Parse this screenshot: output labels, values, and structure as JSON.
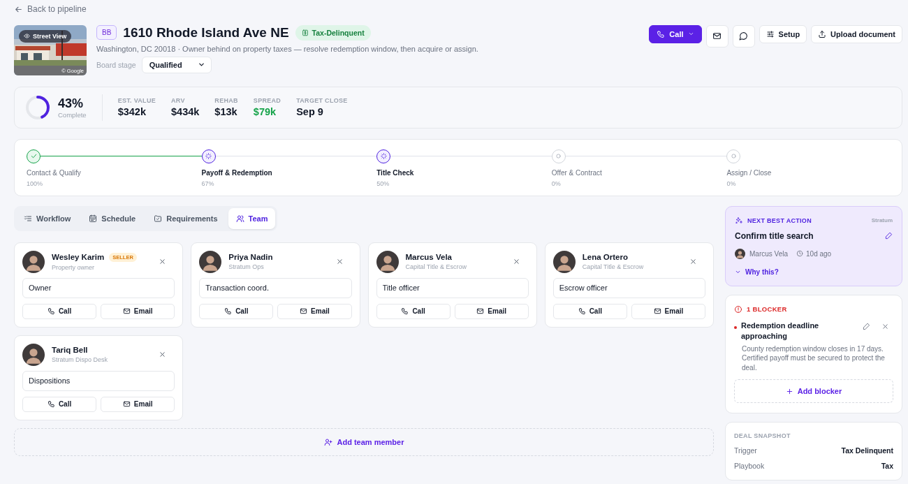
{
  "back_link": "Back to pipeline",
  "property": {
    "photo": {
      "kind": "picture",
      "badge": "Street View",
      "credit": "© Google"
    },
    "initials": "BB",
    "title": "1610 Rhode Island Ave NE",
    "tag": "Tax-Delinquent",
    "description": "Washington, DC 20018 · Owner behind on property taxes — resolve redemption window, then acquire or assign.",
    "board_stage": {
      "label": "Board stage",
      "value": "Qualified"
    }
  },
  "actions": [
    {
      "kind": "call",
      "label": "Call"
    },
    {
      "kind": "email"
    },
    {
      "kind": "message"
    },
    {
      "kind": "setup",
      "label": "Setup"
    },
    {
      "kind": "upload",
      "label": "Upload document"
    }
  ],
  "progress": {
    "level": 0.43,
    "percent": "43%",
    "caption": "Complete"
  },
  "stats": [
    {
      "label": "EST. VALUE",
      "value": "$342k",
      "color": "#111827"
    },
    {
      "label": "ARV",
      "value": "$434k",
      "color": "#111827"
    },
    {
      "label": "REHAB",
      "value": "$13k",
      "color": "#111827"
    },
    {
      "label": "SPREAD",
      "value": "$79k",
      "color": "#16a34a"
    },
    {
      "label": "TARGET CLOSE",
      "value": "Sep 9",
      "color": "#111827"
    }
  ],
  "stages": [
    {
      "name": "Contact & Qualify",
      "percent": "100%",
      "done": true,
      "active": false
    },
    {
      "name": "Payoff & Redemption",
      "percent": "67%",
      "done": false,
      "active": true
    },
    {
      "name": "Title Check",
      "percent": "50%",
      "done": false,
      "active": true
    },
    {
      "name": "Offer & Contract",
      "percent": "0%",
      "done": false,
      "active": false
    },
    {
      "name": "Assign / Close",
      "percent": "0%",
      "done": false,
      "active": false
    }
  ],
  "tabs": [
    {
      "kind": "workflow",
      "label": "Workflow",
      "selected": false
    },
    {
      "kind": "schedule",
      "label": "Schedule",
      "selected": false
    },
    {
      "kind": "requirements",
      "label": "Requirements",
      "selected": false
    },
    {
      "kind": "team",
      "label": "Team",
      "selected": true
    }
  ],
  "team": [
    {
      "name": "Wesley Karim",
      "tag": "SELLER",
      "org": "Property owner",
      "role": "Owner",
      "buttons": [
        "Call",
        "Email"
      ]
    },
    {
      "name": "Priya Nadin",
      "org": "Stratum Ops",
      "role": "Transaction coord.",
      "buttons": [
        "Call",
        "Email"
      ]
    },
    {
      "name": "Marcus Vela",
      "org": "Capital Title & Escrow",
      "role": "Title officer",
      "buttons": [
        "Call",
        "Email"
      ]
    },
    {
      "name": "Lena Ortero",
      "org": "Capital Title & Escrow",
      "role": "Escrow officer",
      "buttons": [
        "Call",
        "Email"
      ]
    },
    {
      "name": "Tariq Bell",
      "org": "Stratum Dispo Desk",
      "role": "Dispositions",
      "buttons": [
        "Call",
        "Email"
      ]
    }
  ],
  "add_member": "Add team member",
  "next_action": {
    "heading": "NEXT BEST ACTION",
    "source": "Stratum",
    "title": "Confirm title search",
    "assignee": "Marcus Vela",
    "time": "10d ago",
    "why": "Why this?"
  },
  "blockers": {
    "heading": "1 BLOCKER",
    "items": [
      {
        "title": "Redemption deadline approaching",
        "description": "County redemption window closes in 17 days. Certified payoff must be secured to protect the deal.",
        "color": "#dc2626"
      }
    ],
    "add": "Add blocker"
  },
  "snapshot": {
    "heading": "DEAL SNAPSHOT",
    "rows": [
      {
        "label": "Trigger",
        "value": "Tax Delinquent"
      },
      {
        "label": "Playbook",
        "value": "Tax"
      }
    ]
  }
}
